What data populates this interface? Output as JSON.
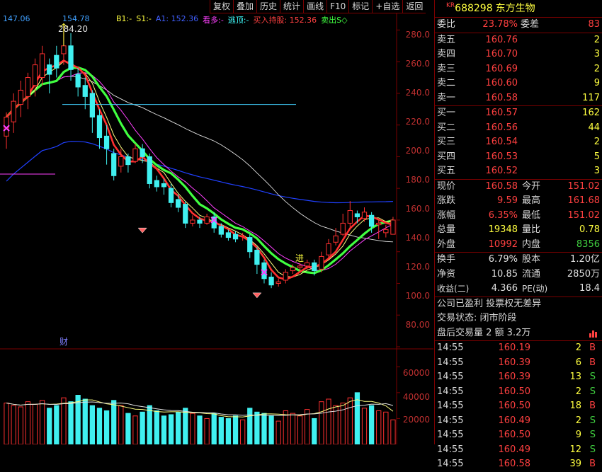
{
  "toolbar": [
    "复权",
    "叠加",
    "历史",
    "统计",
    "画线",
    "F10",
    "标记",
    "+自选",
    "返回"
  ],
  "legend": {
    "ma1": "147.06",
    "ma2": "154.78",
    "b1": "B1:-",
    "s1": "S1:-",
    "a1": "A1: 152.36",
    "kanduo": "看多:-",
    "taoding": "逃顶:-",
    "buy": "买入持股: 152.36",
    "sell": "卖出S◇"
  },
  "price_axis": [
    "280.0",
    "260.0",
    "240.0",
    "220.0",
    "200.0",
    "180.0",
    "160.0",
    "140.0",
    "120.0",
    "100.0",
    "80.00"
  ],
  "volume_axis": [
    "60000",
    "40000",
    "20000"
  ],
  "annotations": {
    "high": "284.20",
    "finance": "财",
    "enter": "进"
  },
  "stock": {
    "prefix": "KR",
    "code": "688298",
    "name": "东方生物"
  },
  "weibi": {
    "l1": "委比",
    "v1": "23.78%",
    "l2": "委差",
    "v2": "83"
  },
  "asks": [
    {
      "label": "卖五",
      "price": "160.76",
      "vol": "2"
    },
    {
      "label": "卖四",
      "price": "160.70",
      "vol": "3"
    },
    {
      "label": "卖三",
      "price": "160.69",
      "vol": "2"
    },
    {
      "label": "卖二",
      "price": "160.60",
      "vol": "9"
    },
    {
      "label": "卖一",
      "price": "160.58",
      "vol": "117"
    }
  ],
  "bids": [
    {
      "label": "买一",
      "price": "160.57",
      "vol": "162"
    },
    {
      "label": "买二",
      "price": "160.56",
      "vol": "44"
    },
    {
      "label": "买三",
      "price": "160.54",
      "vol": "2"
    },
    {
      "label": "买四",
      "price": "160.53",
      "vol": "5"
    },
    {
      "label": "买五",
      "price": "160.52",
      "vol": "3"
    }
  ],
  "quote": [
    {
      "l1": "现价",
      "v1": "160.58",
      "l2": "今开",
      "v2": "151.02"
    },
    {
      "l1": "涨跌",
      "v1": "9.59",
      "l2": "最高",
      "v2": "161.68"
    },
    {
      "l1": "涨幅",
      "v1": "6.35%",
      "l2": "最低",
      "v2": "151.02"
    },
    {
      "l1": "总量",
      "v1": "19348",
      "l2": "量比",
      "v2": "0.78"
    },
    {
      "l1": "外盘",
      "v1": "10992",
      "l2": "内盘",
      "v2": "8356"
    }
  ],
  "extra": [
    {
      "l1": "换手",
      "v1": "6.79%",
      "l2": "股本",
      "v2": "1.20亿"
    },
    {
      "l1": "净资",
      "v1": "10.85",
      "l2": "流通",
      "v2": "2850万"
    },
    {
      "l1": "收益(二)",
      "v1": "4.366",
      "l2": "PE(动)",
      "v2": "18.4"
    }
  ],
  "info": {
    "line1": "公司已盈利 投票权无差异",
    "line2": "交易状态: 闭市阶段",
    "line3": "盘后交易量 2 额 3.2万"
  },
  "ticks": [
    {
      "time": "14:55",
      "price": "160.19",
      "vol": "2",
      "side": "B"
    },
    {
      "time": "14:55",
      "price": "160.39",
      "vol": "6",
      "side": "B"
    },
    {
      "time": "14:55",
      "price": "160.39",
      "vol": "13",
      "side": "S"
    },
    {
      "time": "14:55",
      "price": "160.50",
      "vol": "2",
      "side": "S"
    },
    {
      "time": "14:55",
      "price": "160.50",
      "vol": "18",
      "side": "B"
    },
    {
      "time": "14:55",
      "price": "160.49",
      "vol": "2",
      "side": "S"
    },
    {
      "time": "14:55",
      "price": "160.50",
      "vol": "9",
      "side": "S"
    },
    {
      "time": "14:55",
      "price": "160.49",
      "vol": "12",
      "side": "S"
    },
    {
      "time": "14:55",
      "price": "160.58",
      "vol": "39",
      "side": "B"
    }
  ],
  "colors": {
    "up": "#ff3030",
    "down": "#40f0f0",
    "border": "#7a0000"
  },
  "chart_data": {
    "type": "candlestick",
    "ylim": [
      80,
      290
    ],
    "volume_ylim": [
      0,
      70000
    ],
    "candles": [
      [
        213,
        225,
        205,
        228
      ],
      [
        222,
        235,
        215,
        240
      ],
      [
        233,
        242,
        225,
        248
      ],
      [
        238,
        250,
        230,
        253
      ],
      [
        245,
        258,
        238,
        262
      ],
      [
        250,
        265,
        245,
        270
      ],
      [
        258,
        252,
        240,
        262
      ],
      [
        264,
        256,
        250,
        270
      ],
      [
        265,
        270,
        258,
        284
      ],
      [
        270,
        255,
        248,
        278
      ],
      [
        252,
        244,
        238,
        256
      ],
      [
        245,
        238,
        230,
        250
      ],
      [
        240,
        225,
        215,
        242
      ],
      [
        226,
        212,
        205,
        230
      ],
      [
        213,
        205,
        195,
        220
      ],
      [
        202,
        188,
        185,
        205
      ],
      [
        194,
        200,
        190,
        205
      ],
      [
        200,
        195,
        190,
        202
      ],
      [
        197,
        205,
        196,
        208
      ],
      [
        205,
        200,
        196,
        208
      ],
      [
        200,
        183,
        180,
        202
      ],
      [
        185,
        181,
        178,
        188
      ],
      [
        183,
        181,
        176,
        186
      ],
      [
        180,
        171,
        168,
        183
      ],
      [
        173,
        168,
        165,
        176
      ],
      [
        170,
        158,
        155,
        172
      ],
      [
        158,
        160,
        156,
        163
      ],
      [
        160,
        158,
        155,
        162
      ],
      [
        158,
        162,
        157,
        164
      ],
      [
        162,
        155,
        152,
        165
      ],
      [
        156,
        151,
        149,
        158
      ],
      [
        152,
        149,
        147,
        154
      ],
      [
        151,
        148,
        146,
        153
      ],
      [
        150,
        150,
        147,
        152
      ],
      [
        149,
        140,
        136,
        151
      ],
      [
        141,
        132,
        126,
        143
      ],
      [
        133,
        123,
        120,
        135
      ],
      [
        124,
        119,
        117,
        127
      ],
      [
        120,
        121,
        118,
        123
      ],
      [
        122,
        127,
        120,
        129
      ],
      [
        128,
        130,
        126,
        132
      ],
      [
        130,
        131,
        128,
        133
      ],
      [
        131,
        133,
        129,
        135
      ],
      [
        133,
        128,
        125,
        135
      ],
      [
        129,
        137,
        127,
        140
      ],
      [
        138,
        145,
        136,
        148
      ],
      [
        146,
        150,
        144,
        155
      ],
      [
        151,
        158,
        150,
        164
      ],
      [
        158,
        166,
        155,
        172
      ],
      [
        164,
        162,
        158,
        166
      ],
      [
        161,
        165,
        159,
        168
      ],
      [
        163,
        156,
        152,
        165
      ],
      [
        157,
        158,
        148,
        160
      ],
      [
        152,
        154,
        149,
        157
      ],
      [
        151,
        160,
        151,
        162
      ]
    ],
    "volumes": [
      32000,
      30000,
      29000,
      33000,
      31000,
      34000,
      28000,
      30000,
      36000,
      33000,
      38000,
      35000,
      30000,
      28000,
      26000,
      34000,
      30000,
      24000,
      22000,
      25000,
      30000,
      26000,
      22000,
      23000,
      25000,
      28000,
      24000,
      22000,
      20000,
      24000,
      21000,
      20000,
      22000,
      19000,
      28000,
      25000,
      24000,
      22000,
      18000,
      26000,
      24000,
      22000,
      27000,
      20000,
      33000,
      35000,
      30000,
      32000,
      36000,
      40000,
      28000,
      30000,
      26000,
      25000,
      19000
    ]
  }
}
